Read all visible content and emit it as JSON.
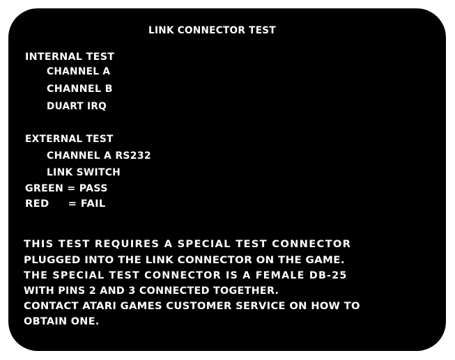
{
  "screen": {
    "background_color": "#000000",
    "text_color": "#ffffff",
    "title": "LINK CONNECTOR TEST",
    "internal_test": {
      "heading": "INTERNAL TEST",
      "items": [
        "CHANNEL A",
        "CHANNEL B",
        "DUART IRQ"
      ]
    },
    "external_test": {
      "heading": "EXTERNAL TEST",
      "items": [
        "CHANNEL A RS232",
        "LINK SWITCH"
      ]
    },
    "legend": {
      "pass": "GREEN = PASS",
      "fail": "RED     = FAIL"
    },
    "instructions": [
      "THIS TEST REQUIRES A SPECIAL TEST CONNECTOR",
      "PLUGGED INTO THE LINK CONNECTOR ON THE GAME.",
      "THE SPECIAL TEST CONNECTOR IS A FEMALE DB-25",
      "WITH PINS 2 AND 3 CONNECTED TOGETHER.",
      "CONTACT ATARI GAMES CUSTOMER SERVICE ON HOW TO",
      "OBTAIN ONE."
    ]
  }
}
